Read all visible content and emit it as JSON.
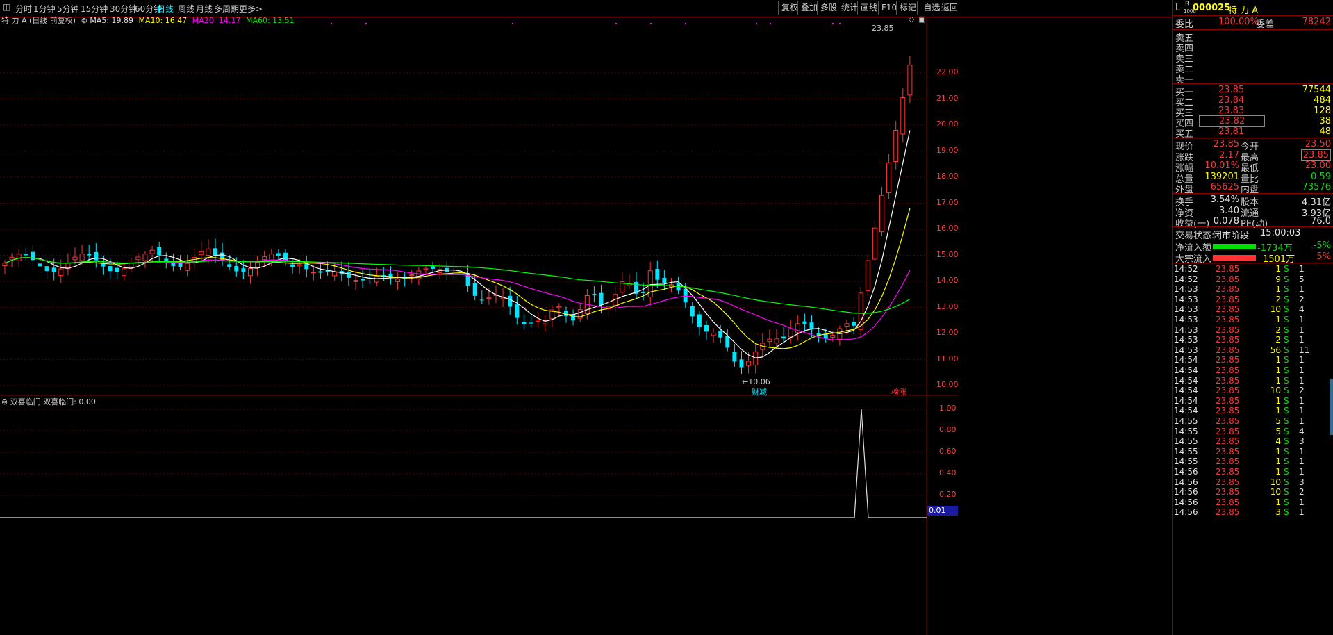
{
  "topbar": {
    "periods": [
      "分时",
      "1分钟",
      "5分钟",
      "15分钟",
      "30分钟",
      "60分钟",
      "日线",
      "周线",
      "月线",
      "多周期",
      "更多>"
    ],
    "active_period": "日线",
    "actions": [
      "复权",
      "叠加",
      "多股",
      "统计",
      "画线",
      "F10",
      "标记",
      "-自选",
      "返回"
    ]
  },
  "main_chart": {
    "title": "特 力 A (日线 前复权)",
    "ma5": "MA5: 19.89",
    "ma10": "MA10: 16.47",
    "ma20": "MA20: 14.17",
    "ma60": "MA60: 13.51",
    "high_label": "23.85",
    "low_label": "10.06",
    "marker_left": "财减",
    "marker_right": "榜涨",
    "y_ticks": [
      "22.00",
      "21.00",
      "20.00",
      "19.00",
      "18.00",
      "17.00",
      "16.00",
      "15.00",
      "14.00",
      "13.00",
      "12.00",
      "11.00",
      "10.00"
    ],
    "colors": {
      "ma5": "#ffffff",
      "ma10": "#ffff00",
      "ma20": "#ff00ff",
      "ma60": "#00ff00",
      "up": "#ff3333",
      "down": "#00e5ff"
    }
  },
  "sub_chart": {
    "title": "双喜临门 双喜临门: 0.00",
    "y_ticks": [
      "1.00",
      "0.80",
      "0.60",
      "0.40",
      "0.20"
    ],
    "cursor_value": "0.01"
  },
  "quote": {
    "prefix": "L",
    "superscript": "R",
    "sub_tag": "1000",
    "code": "000025",
    "name": "特 力 A",
    "wei_bi_label": "委比",
    "wei_bi": "100.00%",
    "wei_cha_label": "委差",
    "wei_cha": "78242",
    "sell_levels": [
      "卖五",
      "卖四",
      "卖三",
      "卖二",
      "卖一"
    ],
    "buy_levels": [
      {
        "label": "买一",
        "price": "23.85",
        "vol": "77544"
      },
      {
        "label": "买二",
        "price": "23.84",
        "vol": "484"
      },
      {
        "label": "买三",
        "price": "23.83",
        "vol": "128"
      },
      {
        "label": "买四",
        "price": "23.82",
        "vol": "38"
      },
      {
        "label": "买五",
        "price": "23.81",
        "vol": "48"
      }
    ],
    "stats_left": [
      {
        "label": "现价",
        "value": "23.85",
        "color": "red"
      },
      {
        "label": "涨跌",
        "value": "2.17",
        "color": "red"
      },
      {
        "label": "涨幅",
        "value": "10.01%",
        "color": "red"
      },
      {
        "label": "总量",
        "value": "139201",
        "color": "yellow"
      },
      {
        "label": "外盘",
        "value": "65625",
        "color": "red"
      }
    ],
    "stats_right": [
      {
        "label": "今开",
        "value": "23.50",
        "color": "red"
      },
      {
        "label": "最高",
        "value": "23.85",
        "color": "red"
      },
      {
        "label": "最低",
        "value": "23.00",
        "color": "red"
      },
      {
        "label": "量比",
        "value": "0.59",
        "color": "green"
      },
      {
        "label": "内盘",
        "value": "73576",
        "color": "green"
      }
    ],
    "fin_left": [
      {
        "label": "换手",
        "value": "3.54%"
      },
      {
        "label": "净资",
        "value": "3.40"
      },
      {
        "label": "收益(一)",
        "value": "0.078"
      }
    ],
    "fin_right": [
      {
        "label": "股本",
        "value": "4.31亿"
      },
      {
        "label": "流通",
        "value": "3.93亿"
      },
      {
        "label": "PE(动)",
        "value": "76.0"
      }
    ],
    "trade_status_label": "交易状态:",
    "trade_status": "闭市阶段",
    "trade_time": "15:00:03",
    "net_inflow_label": "净流入额",
    "net_inflow": "-1734万",
    "net_inflow_pct": "-5%",
    "big_inflow_label": "大宗流入",
    "big_inflow": "1501万",
    "big_inflow_pct": "5%"
  },
  "ticks": [
    {
      "time": "14:52",
      "price": "23.85",
      "vol": "1",
      "side": "S",
      "n": "1"
    },
    {
      "time": "14:52",
      "price": "23.85",
      "vol": "9",
      "side": "S",
      "n": "5"
    },
    {
      "time": "14:53",
      "price": "23.85",
      "vol": "1",
      "side": "S",
      "n": "1"
    },
    {
      "time": "14:53",
      "price": "23.85",
      "vol": "2",
      "side": "S",
      "n": "2"
    },
    {
      "time": "14:53",
      "price": "23.85",
      "vol": "10",
      "side": "S",
      "n": "4"
    },
    {
      "time": "14:53",
      "price": "23.85",
      "vol": "1",
      "side": "S",
      "n": "1"
    },
    {
      "time": "14:53",
      "price": "23.85",
      "vol": "2",
      "side": "S",
      "n": "1"
    },
    {
      "time": "14:53",
      "price": "23.85",
      "vol": "2",
      "side": "S",
      "n": "1"
    },
    {
      "time": "14:53",
      "price": "23.85",
      "vol": "56",
      "side": "S",
      "n": "11"
    },
    {
      "time": "14:54",
      "price": "23.85",
      "vol": "1",
      "side": "S",
      "n": "1"
    },
    {
      "time": "14:54",
      "price": "23.85",
      "vol": "1",
      "side": "S",
      "n": "1"
    },
    {
      "time": "14:54",
      "price": "23.85",
      "vol": "1",
      "side": "S",
      "n": "1"
    },
    {
      "time": "14:54",
      "price": "23.85",
      "vol": "10",
      "side": "S",
      "n": "2"
    },
    {
      "time": "14:54",
      "price": "23.85",
      "vol": "1",
      "side": "S",
      "n": "1"
    },
    {
      "time": "14:54",
      "price": "23.85",
      "vol": "1",
      "side": "S",
      "n": "1"
    },
    {
      "time": "14:55",
      "price": "23.85",
      "vol": "5",
      "side": "S",
      "n": "1"
    },
    {
      "time": "14:55",
      "price": "23.85",
      "vol": "5",
      "side": "S",
      "n": "4"
    },
    {
      "time": "14:55",
      "price": "23.85",
      "vol": "4",
      "side": "S",
      "n": "3"
    },
    {
      "time": "14:55",
      "price": "23.85",
      "vol": "1",
      "side": "S",
      "n": "1"
    },
    {
      "time": "14:55",
      "price": "23.85",
      "vol": "1",
      "side": "S",
      "n": "1"
    },
    {
      "time": "14:56",
      "price": "23.85",
      "vol": "1",
      "side": "S",
      "n": "1"
    },
    {
      "time": "14:56",
      "price": "23.85",
      "vol": "10",
      "side": "S",
      "n": "3"
    },
    {
      "time": "14:56",
      "price": "23.85",
      "vol": "10",
      "side": "S",
      "n": "2"
    },
    {
      "time": "14:56",
      "price": "23.85",
      "vol": "1",
      "side": "S",
      "n": "1"
    },
    {
      "time": "14:56",
      "price": "23.85",
      "vol": "3",
      "side": "S",
      "n": "1"
    }
  ]
}
